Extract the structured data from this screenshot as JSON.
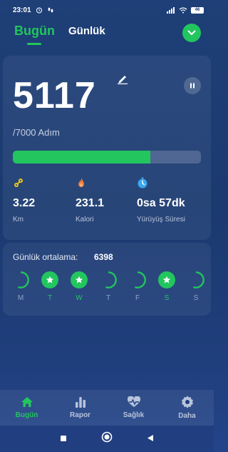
{
  "status_bar": {
    "time": "23:01",
    "battery": "46"
  },
  "header": {
    "tab_today": "Bugün",
    "tab_daily": "Günlük"
  },
  "main": {
    "steps": "5117",
    "goal_text": "/7000 Adım",
    "progress_fraction": 0.731,
    "metrics": [
      {
        "icon": "route-icon",
        "value": "3.22",
        "label": "Km",
        "color": "#e8c21a"
      },
      {
        "icon": "flame-icon",
        "value": "231.1",
        "label": "Kalori",
        "color": "#f07a3a"
      },
      {
        "icon": "timer-icon",
        "value": "0sa 57dk",
        "label": "Yürüyüş Süresi",
        "color": "#3aa8f0"
      }
    ]
  },
  "daily_average": {
    "label": "Günlük ortalama:",
    "value": "6398",
    "days": [
      {
        "letter": "M",
        "state": "partial",
        "active": false
      },
      {
        "letter": "T",
        "state": "done",
        "active": true
      },
      {
        "letter": "W",
        "state": "done",
        "active": true
      },
      {
        "letter": "T",
        "state": "partial",
        "active": false
      },
      {
        "letter": "F",
        "state": "partial",
        "active": false
      },
      {
        "letter": "S",
        "state": "done",
        "active": true
      },
      {
        "letter": "S",
        "state": "partial",
        "active": false
      }
    ]
  },
  "bottom_nav": [
    {
      "label": "Bugün",
      "icon": "home-icon",
      "active": true
    },
    {
      "label": "Rapor",
      "icon": "report-icon",
      "active": false
    },
    {
      "label": "Sağlık",
      "icon": "heart-pulse-icon",
      "active": false
    },
    {
      "label": "Daha",
      "icon": "gear-icon",
      "active": false
    }
  ],
  "colors": {
    "accent": "#22c55e",
    "background": "#1e3f77"
  }
}
